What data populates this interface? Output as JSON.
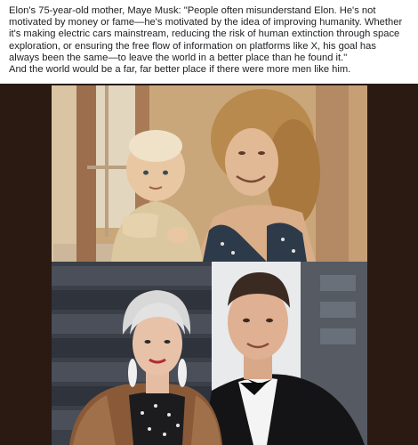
{
  "post": {
    "body": "Elon's 75-year-old mother, Maye Musk: \"People often misunderstand Elon.  He's not motivated by money or fame—he's motivated by the idea of improving humanity.  Whether it's making electric cars mainstream, reducing the risk of human extinction through space exploration, or ensuring the free flow of information on platforms like X, his goal has always been the same—to leave the world in a better place than he found it.\"",
    "closing": "And the world would be a far, far better place if there were more men like him."
  },
  "photos": {
    "top_photo": "vintage-mother-and-baby-photo",
    "bottom_photo": "mother-and-son-red-carpet-photo"
  },
  "colors": {
    "frame_background": "#2a1a12",
    "text": "#1c1e21",
    "sepia_wall": "#c9a77a",
    "curtain": "#9c6e4e",
    "backdrop": "#3b3f47"
  }
}
